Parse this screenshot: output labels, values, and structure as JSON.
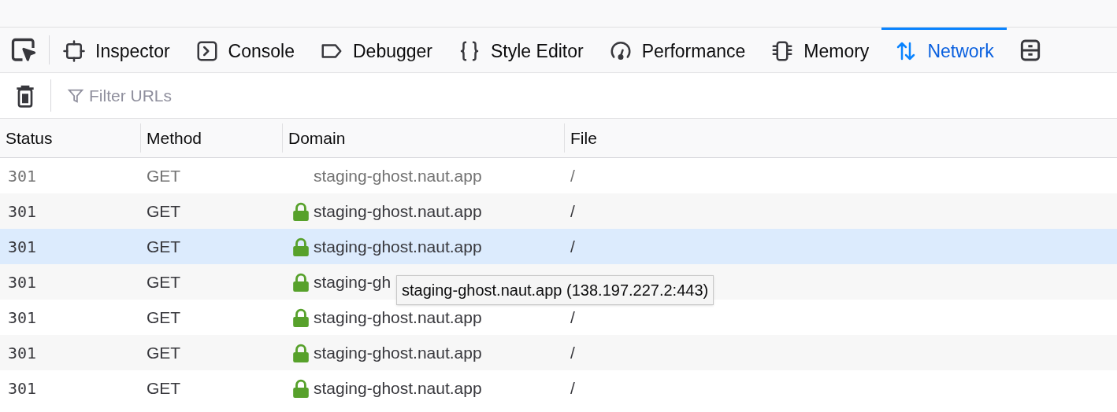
{
  "tabs": [
    {
      "label": "Inspector",
      "kind": "inspector",
      "selected": false
    },
    {
      "label": "Console",
      "kind": "console",
      "selected": false
    },
    {
      "label": "Debugger",
      "kind": "debugger",
      "selected": false
    },
    {
      "label": "Style Editor",
      "kind": "style",
      "selected": false
    },
    {
      "label": "Performance",
      "kind": "performance",
      "selected": false
    },
    {
      "label": "Memory",
      "kind": "memory",
      "selected": false
    },
    {
      "label": "Network",
      "kind": "network",
      "selected": true
    }
  ],
  "filter": {
    "placeholder": "Filter URLs"
  },
  "table": {
    "columns": [
      "Status",
      "Method",
      "Domain",
      "File"
    ],
    "rows": [
      {
        "status": "301",
        "method": "GET",
        "domain": "staging-ghost.naut.app",
        "file": "/",
        "secure": false,
        "muted": true,
        "selected": false
      },
      {
        "status": "301",
        "method": "GET",
        "domain": "staging-ghost.naut.app",
        "file": "/",
        "secure": true,
        "muted": false,
        "selected": false
      },
      {
        "status": "301",
        "method": "GET",
        "domain": "staging-ghost.naut.app",
        "file": "/",
        "secure": true,
        "muted": false,
        "selected": true
      },
      {
        "status": "301",
        "method": "GET",
        "domain": "staging-gh",
        "secure": true,
        "muted": false,
        "selected": false,
        "tooltip": "staging-ghost.naut.app (138.197.227.2:443)"
      },
      {
        "status": "301",
        "method": "GET",
        "domain": "staging-ghost.naut.app",
        "file": "/",
        "secure": true,
        "muted": false,
        "selected": false
      },
      {
        "status": "301",
        "method": "GET",
        "domain": "staging-ghost.naut.app",
        "file": "/",
        "secure": true,
        "muted": false,
        "selected": false
      },
      {
        "status": "301",
        "method": "GET",
        "domain": "staging-ghost.naut.app",
        "file": "/",
        "secure": true,
        "muted": false,
        "selected": false
      }
    ]
  }
}
